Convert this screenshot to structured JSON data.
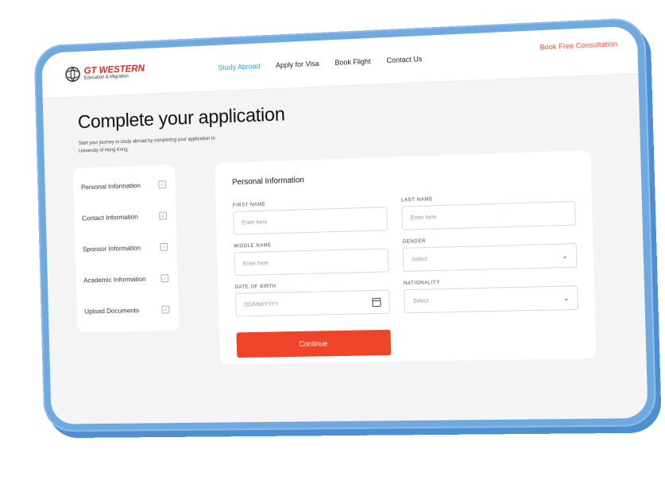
{
  "brand": {
    "name": "GT WESTERN",
    "tagline": "Education & Migration"
  },
  "nav": {
    "items": [
      "Study Abroad",
      "Apply for Visa",
      "Book Flight",
      "Contact Us"
    ],
    "active": "Study Abroad"
  },
  "cta": "Book Free Consultation",
  "page": {
    "title": "Complete your application",
    "subtitle": "Start your journey to study abroad by completing your application to University of Hong Kong."
  },
  "steps": [
    "Personal Information",
    "Contact Information",
    "Sponsor Information",
    "Academic Information",
    "Upload Documents"
  ],
  "form": {
    "title": "Personal Information",
    "fields": {
      "first_name": {
        "label": "FIRST NAME",
        "placeholder": "Enter here"
      },
      "last_name": {
        "label": "LAST NAME",
        "placeholder": "Enter here"
      },
      "middle_name": {
        "label": "MIDDLE NAME",
        "placeholder": "Enter here"
      },
      "gender": {
        "label": "GENDER",
        "value": "Select"
      },
      "dob": {
        "label": "DATE OF BIRTH",
        "placeholder": "DD/MM/YYYY"
      },
      "nationality": {
        "label": "NATIONALITY",
        "value": "Select"
      }
    },
    "submit": "Continue"
  },
  "colors": {
    "accent": "#f0442a",
    "nav_active": "#2aa0e0",
    "brand_red": "#d92a2a",
    "device": "#6fa9e0"
  }
}
